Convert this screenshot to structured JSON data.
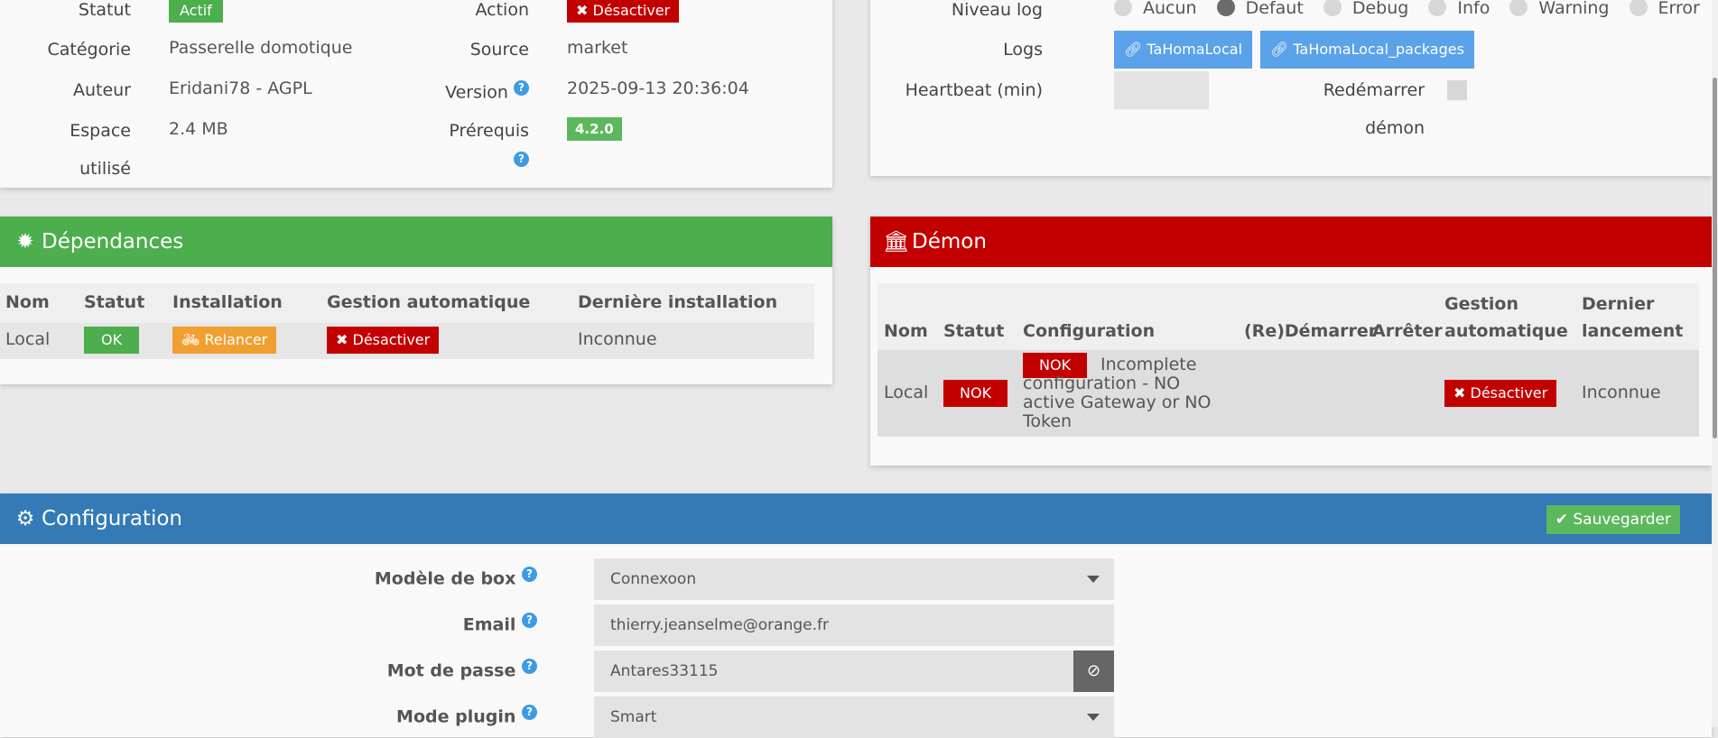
{
  "info": {
    "statut_label": "Statut",
    "statut_value": "Actif",
    "action_label": "Action",
    "action_button": "Désactiver",
    "categorie_label": "Catégorie",
    "categorie_value": "Passerelle domotique",
    "source_label": "Source",
    "source_value": "market",
    "auteur_label": "Auteur",
    "auteur_value": "Eridani78 - AGPL",
    "version_label": "Version",
    "version_value": "2025-09-13 20:36:04",
    "espace_label_1": "Espace",
    "espace_label_2": "utilisé",
    "espace_value": "2.4 MB",
    "prerequis_label": "Prérequis",
    "prerequis_value": "4.2.0"
  },
  "logs": {
    "niveau_label": "Niveau log",
    "levels": [
      "Aucun",
      "Defaut",
      "Debug",
      "Info",
      "Warning",
      "Error"
    ],
    "selected_level": "Defaut",
    "logs_label": "Logs",
    "log_buttons": [
      "TaHomaLocal",
      "TaHomaLocal_packages"
    ],
    "heartbeat_label": "Heartbeat (min)",
    "heartbeat_value": "",
    "restart_label_1": "Redémarrer",
    "restart_label_2": "démon"
  },
  "dependances": {
    "title": "Dépendances",
    "headers": [
      "Nom",
      "Statut",
      "Installation",
      "Gestion automatique",
      "Dernière installation"
    ],
    "row": {
      "nom": "Local",
      "statut": "OK",
      "installation": "Relancer",
      "gestion": "Désactiver",
      "derniere": "Inconnue"
    }
  },
  "demon": {
    "title": "Démon",
    "headers": [
      "Nom",
      "Statut",
      "Configuration",
      "(Re)Démarrer",
      "Arrêter",
      "Gestion",
      "automatique",
      "Dernier",
      "lancement"
    ],
    "row": {
      "nom": "Local",
      "statut": "NOK",
      "config_badge": "NOK",
      "config_text_1": "Incomplete",
      "config_text_2": "configuration - NO",
      "config_text_3": "active Gateway or NO",
      "config_text_4": "Token",
      "gestion": "Désactiver",
      "dernier": "Inconnue"
    }
  },
  "configuration": {
    "title": "Configuration",
    "save_button": "Sauvegarder",
    "fields": [
      {
        "label": "Modèle de box",
        "value": "Connexoon"
      },
      {
        "label": "Email",
        "value": "thierry.jeanselme@orange.fr"
      },
      {
        "label": "Mot de passe",
        "value": "Antares33115"
      },
      {
        "label": "Mode plugin",
        "value": "Smart"
      }
    ]
  },
  "colors": {
    "green": "#4cae4c",
    "red": "#c30000",
    "blue": "#337ab7",
    "orange": "#f0a030",
    "link_blue": "#5aa2e9"
  }
}
